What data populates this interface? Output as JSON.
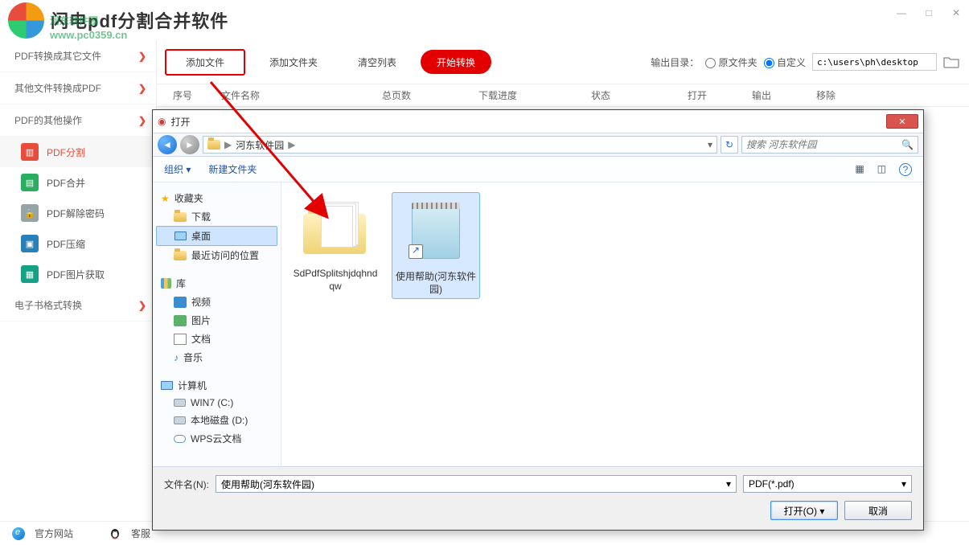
{
  "app": {
    "title": "闪电pdf分割合并软件",
    "watermark_top": "河东软件园",
    "watermark_url": "www.pc0359.cn"
  },
  "win_ctrl": {
    "min": "—",
    "max": "□",
    "close": "✕"
  },
  "sidebar": {
    "cats": [
      {
        "label": "PDF转换成其它文件",
        "arrow": "❯"
      },
      {
        "label": "其他文件转换成PDF",
        "arrow": "❯"
      },
      {
        "label": "PDF的其他操作",
        "arrow": "❯"
      },
      {
        "label": "电子书格式转换",
        "arrow": "❯"
      }
    ],
    "items": [
      {
        "label": "PDF分割",
        "cls": "ico-red",
        "active": true
      },
      {
        "label": "PDF合并",
        "cls": "ico-green"
      },
      {
        "label": "PDF解除密码",
        "cls": "ico-grey"
      },
      {
        "label": "PDF压缩",
        "cls": "ico-blue"
      },
      {
        "label": "PDF图片获取",
        "cls": "ico-dgrn"
      }
    ]
  },
  "toolbar": {
    "add_file": "添加文件",
    "add_folder": "添加文件夹",
    "clear": "清空列表",
    "start": "开始转换",
    "out_label": "输出目录：",
    "out_src": "原文件夹",
    "out_custom": "自定义",
    "path": "c:\\users\\ph\\desktop"
  },
  "columns": {
    "c1": "序号",
    "c2": "文件名称",
    "c3": "总页数",
    "c4": "下载进度",
    "c5": "状态",
    "c6": "打开",
    "c7": "输出",
    "c8": "移除"
  },
  "statusbar": {
    "web": "官方网站",
    "kf": "客服"
  },
  "dialog": {
    "title": "打开",
    "bc_root": "河东软件园",
    "bc_sep": "▶",
    "search_ph": "搜索 河东软件园",
    "organize": "组织 ▾",
    "newfolder": "新建文件夹",
    "view_icons": {
      "a": "▦",
      "b": "◫",
      "c": "?"
    },
    "tree": {
      "fav": "收藏夹",
      "dl": "下载",
      "desk": "桌面",
      "recent": "最近访问的位置",
      "lib": "库",
      "vid": "视频",
      "pic": "图片",
      "doc": "文档",
      "music": "音乐",
      "pc": "计算机",
      "c": "WIN7 (C:)",
      "d": "本地磁盘 (D:)",
      "wps": "WPS云文档"
    },
    "files": [
      {
        "name": "SdPdfSplitshjdqhndqw",
        "type": "folder"
      },
      {
        "name": "使用帮助(河东软件园)",
        "type": "notepad",
        "selected": true
      }
    ],
    "fn_label": "文件名(N):",
    "fn_value": "使用帮助(河东软件园)",
    "filter": "PDF(*.pdf)",
    "open_btn": "打开(O)",
    "cancel_btn": "取消"
  }
}
